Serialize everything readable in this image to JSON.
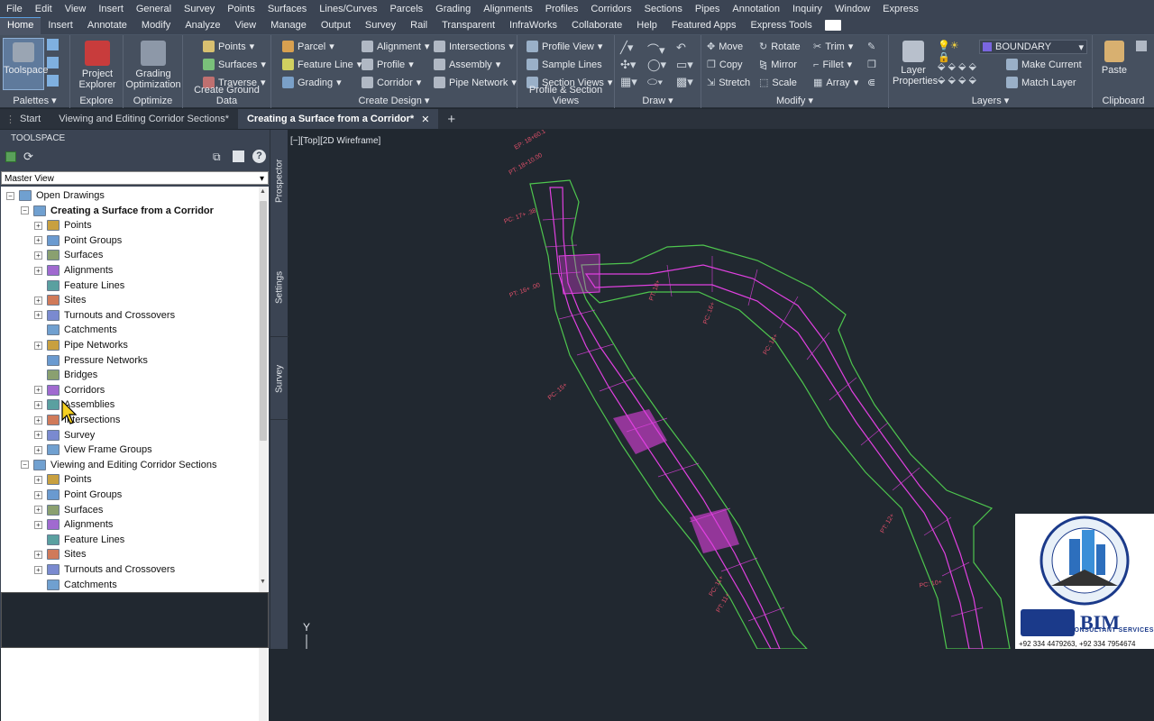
{
  "menu": [
    "File",
    "Edit",
    "View",
    "Insert",
    "General",
    "Survey",
    "Points",
    "Surfaces",
    "Lines/Curves",
    "Parcels",
    "Grading",
    "Alignments",
    "Profiles",
    "Corridors",
    "Sections",
    "Pipes",
    "Annotation",
    "Inquiry",
    "Window",
    "Express"
  ],
  "ribbon_tabs": [
    "Home",
    "Insert",
    "Annotate",
    "Modify",
    "Analyze",
    "View",
    "Manage",
    "Output",
    "Survey",
    "Rail",
    "Transparent",
    "InfraWorks",
    "Collaborate",
    "Help",
    "Featured Apps",
    "Express Tools"
  ],
  "ribbon_active_tab": "Home",
  "ribbon": {
    "palettes": {
      "title": "Palettes",
      "toolspace": "Toolspace"
    },
    "explore": {
      "title": "Explore",
      "project_explorer": "Project Explorer"
    },
    "optimize": {
      "title": "Optimize",
      "grading_optimization": "Grading Optimization"
    },
    "ground": {
      "title": "Create Ground Data",
      "points": "Points",
      "surfaces": "Surfaces",
      "traverse": "Traverse"
    },
    "design": {
      "title": "Create Design",
      "parcel": "Parcel",
      "feature_line": "Feature Line",
      "grading": "Grading",
      "alignment": "Alignment",
      "profile": "Profile",
      "corridor": "Corridor",
      "intersections": "Intersections",
      "assembly": "Assembly",
      "pipe_network": "Pipe Network"
    },
    "profile_section": {
      "title": "Profile & Section Views",
      "profile_view": "Profile View",
      "sample_lines": "Sample Lines",
      "section_views": "Section Views"
    },
    "draw": {
      "title": "Draw"
    },
    "modify": {
      "title": "Modify",
      "move": "Move",
      "copy": "Copy",
      "stretch": "Stretch",
      "rotate": "Rotate",
      "mirror": "Mirror",
      "scale": "Scale",
      "trim": "Trim",
      "fillet": "Fillet",
      "array": "Array"
    },
    "layers": {
      "title": "Layers",
      "layer_properties": "Layer Properties",
      "layer_value": "BOUNDARY",
      "make_current": "Make Current",
      "match_layer": "Match Layer"
    },
    "clipboard": {
      "title": "Clipboard",
      "paste": "Paste"
    }
  },
  "doc_tabs": {
    "start": "Start",
    "tab1": "Viewing and Editing Corridor Sections*",
    "tab2": "Creating a Surface from a Corridor*"
  },
  "toolspace": {
    "title": "TOOLSPACE",
    "view": "Master View",
    "side_tabs": [
      "Prospector",
      "Settings",
      "Survey"
    ],
    "tree": {
      "root": "Open Drawings",
      "drawing1": "Creating a Surface from a Corridor",
      "drawing1_items": [
        "Points",
        "Point Groups",
        "Surfaces",
        "Alignments",
        "Feature Lines",
        "Sites",
        "Turnouts and Crossovers",
        "Catchments",
        "Pipe Networks",
        "Pressure Networks",
        "Bridges",
        "Corridors",
        "Assemblies",
        "Intersections",
        "Survey",
        "View Frame Groups"
      ],
      "drawing2": "Viewing and Editing Corridor Sections",
      "drawing2_items": [
        "Points",
        "Point Groups",
        "Surfaces",
        "Alignments",
        "Feature Lines",
        "Sites",
        "Turnouts and Crossovers",
        "Catchments"
      ]
    }
  },
  "viewport": {
    "label": "[−][Top][2D Wireframe]",
    "ucs_y": "Y"
  },
  "station_labels": [
    "EP: 18+60.1",
    "PT: 18+10.00",
    "PC: 17+ .38",
    "PT: 16+ .00",
    "PT: 18+",
    "PC: 16+",
    "PC: 15+",
    "PC: 14+",
    "PT: 12+",
    "PC: 11+",
    "PT: 11+",
    "PC: 10+"
  ],
  "watermark": {
    "brand": "BIM",
    "sub": "CONSULTANT SERVICES",
    "phone": "+92 334 4479263, +92 334 7954674"
  },
  "colors": {
    "ribbon_bg": "#46505f",
    "menu_bg": "#3b4453",
    "canvas_bg": "#212830",
    "corridor_magenta": "#e040e0",
    "corridor_green": "#4ec64e",
    "label_red": "#e0506a"
  }
}
